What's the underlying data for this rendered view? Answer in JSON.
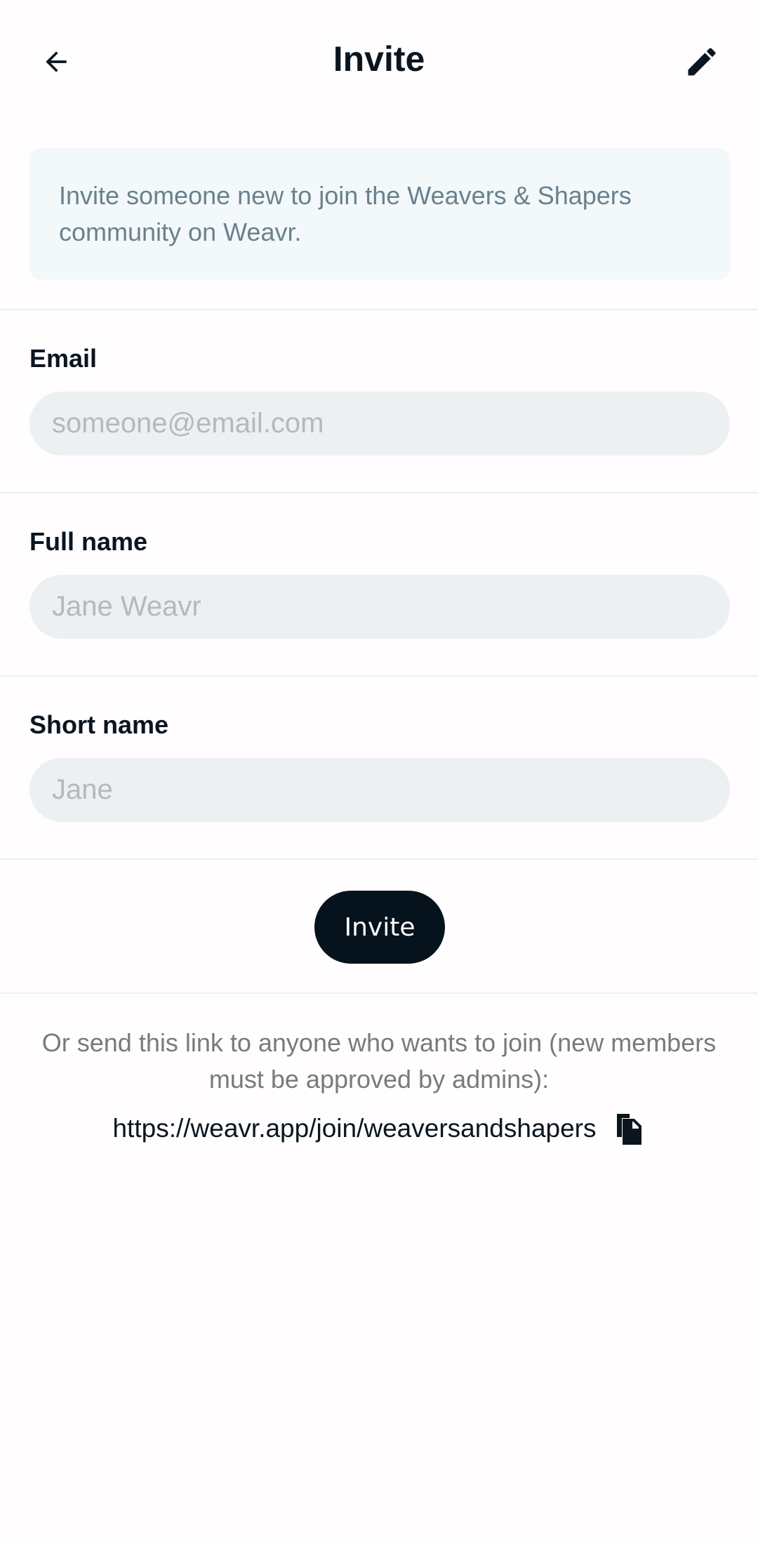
{
  "header": {
    "title": "Invite",
    "back_icon": "arrow-left-icon",
    "edit_icon": "pencil-icon"
  },
  "info": {
    "text": "Invite someone new to join the Weavers & Shapers community on Weavr."
  },
  "form": {
    "email": {
      "label": "Email",
      "value": "",
      "placeholder": "someone@email.com"
    },
    "full_name": {
      "label": "Full name",
      "value": "",
      "placeholder": "Jane Weavr"
    },
    "short_name": {
      "label": "Short name",
      "value": "",
      "placeholder": "Jane"
    },
    "submit_label": "Invite"
  },
  "share": {
    "note": "Or send this link to anyone who wants to join (new members must be approved by admins):",
    "url": "https://weavr.app/join/weaversandshapers",
    "copy_icon": "copy-icon"
  },
  "colors": {
    "primary": "#06131d",
    "info_bg": "#f3f8fb",
    "info_text": "#6a818c",
    "input_bg": "#ecf0f2",
    "placeholder": "#b3b9bd",
    "muted_text": "#7a7a7a"
  }
}
